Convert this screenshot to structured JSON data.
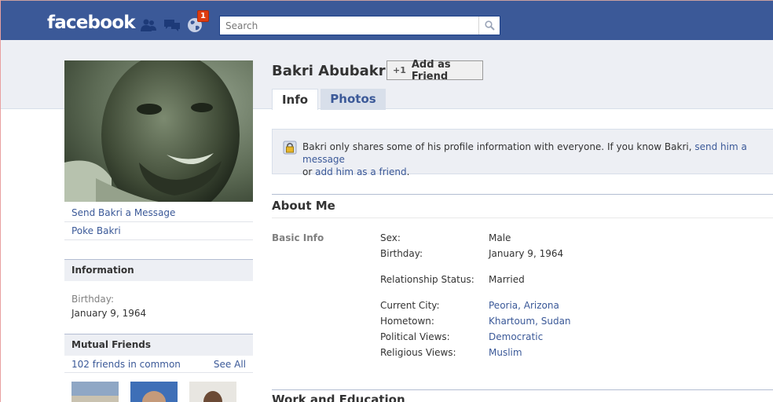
{
  "header": {
    "logo": "facebook",
    "notification_count": "1",
    "search_placeholder": "Search"
  },
  "profile": {
    "name": "Bakri Abubakr",
    "add_friend_label": "Add as Friend",
    "add_friend_icon": "+1",
    "tabs": [
      {
        "label": "Info"
      },
      {
        "label": "Photos"
      }
    ]
  },
  "sidebar": {
    "links": [
      {
        "label": "Send Bakri a Message"
      },
      {
        "label": "Poke Bakri"
      }
    ],
    "information": {
      "heading": "Information",
      "birthday_label": "Birthday:",
      "birthday_value": "January 9, 1964"
    },
    "mutual_friends": {
      "heading": "Mutual Friends",
      "count_text": "102 friends in common",
      "see_all": "See All"
    }
  },
  "notice": {
    "text_before": "Bakri only shares some of his profile information with everyone. If you know Bakri, ",
    "link1": "send him a message",
    "text_middle": "or ",
    "link2": "add him as a friend",
    "text_after": "."
  },
  "about": {
    "title": "About Me",
    "basic_info_label": "Basic Info",
    "rows": [
      {
        "key": "Sex:",
        "value": "Male"
      },
      {
        "key": "Birthday:",
        "value": "January 9, 1964"
      },
      {
        "key": "Relationship Status:",
        "value": "Married"
      },
      {
        "key": "Current City:",
        "value": "Peoria, Arizona"
      },
      {
        "key": "Hometown:",
        "value": "Khartoum, Sudan"
      },
      {
        "key": "Political Views:",
        "value": "Democratic"
      },
      {
        "key": "Religious Views:",
        "value": "Muslim"
      }
    ]
  },
  "work": {
    "title": "Work and Education"
  }
}
